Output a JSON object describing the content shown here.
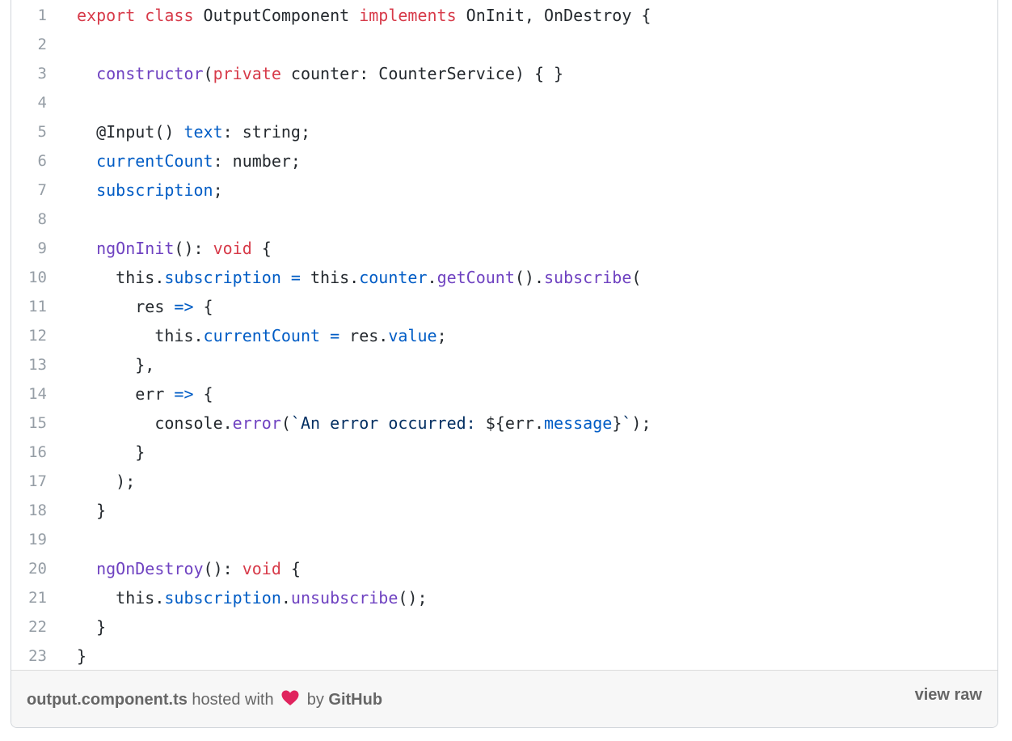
{
  "colors": {
    "keyword": "#d73a49",
    "entity": "#6f42c1",
    "constant": "#005cc5",
    "string": "#032f62",
    "plain": "#24292e",
    "line_number": "#959da5",
    "footer_bg": "#f7f7f7",
    "heart": "#e0245e"
  },
  "code": {
    "lines": [
      {
        "num": "1",
        "tokens": [
          {
            "t": "export class",
            "c": "keyword"
          },
          {
            "t": " OutputComponent ",
            "c": "plain"
          },
          {
            "t": "implements",
            "c": "keyword"
          },
          {
            "t": " OnInit, OnDestroy {",
            "c": "plain"
          }
        ]
      },
      {
        "num": "2",
        "tokens": []
      },
      {
        "num": "3",
        "tokens": [
          {
            "t": "  ",
            "c": "plain"
          },
          {
            "t": "constructor",
            "c": "entity"
          },
          {
            "t": "(",
            "c": "plain"
          },
          {
            "t": "private",
            "c": "keyword"
          },
          {
            "t": " counter: CounterService) { }",
            "c": "plain"
          }
        ]
      },
      {
        "num": "4",
        "tokens": []
      },
      {
        "num": "5",
        "tokens": [
          {
            "t": "  @Input() ",
            "c": "plain"
          },
          {
            "t": "text",
            "c": "constant"
          },
          {
            "t": ": string;",
            "c": "plain"
          }
        ]
      },
      {
        "num": "6",
        "tokens": [
          {
            "t": "  ",
            "c": "plain"
          },
          {
            "t": "currentCount",
            "c": "constant"
          },
          {
            "t": ": number;",
            "c": "plain"
          }
        ]
      },
      {
        "num": "7",
        "tokens": [
          {
            "t": "  ",
            "c": "plain"
          },
          {
            "t": "subscription",
            "c": "constant"
          },
          {
            "t": ";",
            "c": "plain"
          }
        ]
      },
      {
        "num": "8",
        "tokens": []
      },
      {
        "num": "9",
        "tokens": [
          {
            "t": "  ",
            "c": "plain"
          },
          {
            "t": "ngOnInit",
            "c": "entity"
          },
          {
            "t": "(): ",
            "c": "plain"
          },
          {
            "t": "void",
            "c": "keyword"
          },
          {
            "t": " {",
            "c": "plain"
          }
        ]
      },
      {
        "num": "10",
        "tokens": [
          {
            "t": "    this.",
            "c": "plain"
          },
          {
            "t": "subscription",
            "c": "constant"
          },
          {
            "t": " ",
            "c": "plain"
          },
          {
            "t": "=",
            "c": "constant"
          },
          {
            "t": " this.",
            "c": "plain"
          },
          {
            "t": "counter",
            "c": "constant"
          },
          {
            "t": ".",
            "c": "plain"
          },
          {
            "t": "getCount",
            "c": "entity"
          },
          {
            "t": "().",
            "c": "plain"
          },
          {
            "t": "subscribe",
            "c": "entity"
          },
          {
            "t": "(",
            "c": "plain"
          }
        ]
      },
      {
        "num": "11",
        "tokens": [
          {
            "t": "      res ",
            "c": "plain"
          },
          {
            "t": "=>",
            "c": "constant"
          },
          {
            "t": " {",
            "c": "plain"
          }
        ]
      },
      {
        "num": "12",
        "tokens": [
          {
            "t": "        this.",
            "c": "plain"
          },
          {
            "t": "currentCount",
            "c": "constant"
          },
          {
            "t": " ",
            "c": "plain"
          },
          {
            "t": "=",
            "c": "constant"
          },
          {
            "t": " res.",
            "c": "plain"
          },
          {
            "t": "value",
            "c": "constant"
          },
          {
            "t": ";",
            "c": "plain"
          }
        ]
      },
      {
        "num": "13",
        "tokens": [
          {
            "t": "      },",
            "c": "plain"
          }
        ]
      },
      {
        "num": "14",
        "tokens": [
          {
            "t": "      err ",
            "c": "plain"
          },
          {
            "t": "=>",
            "c": "constant"
          },
          {
            "t": " {",
            "c": "plain"
          }
        ]
      },
      {
        "num": "15",
        "tokens": [
          {
            "t": "        console.",
            "c": "plain"
          },
          {
            "t": "error",
            "c": "entity"
          },
          {
            "t": "(",
            "c": "plain"
          },
          {
            "t": "`An error occurred: ",
            "c": "string"
          },
          {
            "t": "${",
            "c": "plain"
          },
          {
            "t": "err.",
            "c": "plain"
          },
          {
            "t": "message",
            "c": "constant"
          },
          {
            "t": "}",
            "c": "plain"
          },
          {
            "t": "`",
            "c": "string"
          },
          {
            "t": ");",
            "c": "plain"
          }
        ]
      },
      {
        "num": "16",
        "tokens": [
          {
            "t": "      }",
            "c": "plain"
          }
        ]
      },
      {
        "num": "17",
        "tokens": [
          {
            "t": "    );",
            "c": "plain"
          }
        ]
      },
      {
        "num": "18",
        "tokens": [
          {
            "t": "  }",
            "c": "plain"
          }
        ]
      },
      {
        "num": "19",
        "tokens": []
      },
      {
        "num": "20",
        "tokens": [
          {
            "t": "  ",
            "c": "plain"
          },
          {
            "t": "ngOnDestroy",
            "c": "entity"
          },
          {
            "t": "(): ",
            "c": "plain"
          },
          {
            "t": "void",
            "c": "keyword"
          },
          {
            "t": " {",
            "c": "plain"
          }
        ]
      },
      {
        "num": "21",
        "tokens": [
          {
            "t": "    this.",
            "c": "plain"
          },
          {
            "t": "subscription",
            "c": "constant"
          },
          {
            "t": ".",
            "c": "plain"
          },
          {
            "t": "unsubscribe",
            "c": "entity"
          },
          {
            "t": "();",
            "c": "plain"
          }
        ]
      },
      {
        "num": "22",
        "tokens": [
          {
            "t": "  }",
            "c": "plain"
          }
        ]
      },
      {
        "num": "23",
        "tokens": [
          {
            "t": "}",
            "c": "plain"
          }
        ]
      }
    ]
  },
  "footer": {
    "filename": "output.component.ts",
    "hosted_with": "hosted with",
    "heart_icon": "heart-icon",
    "by": "by",
    "github": "GitHub",
    "view_raw": "view raw"
  }
}
